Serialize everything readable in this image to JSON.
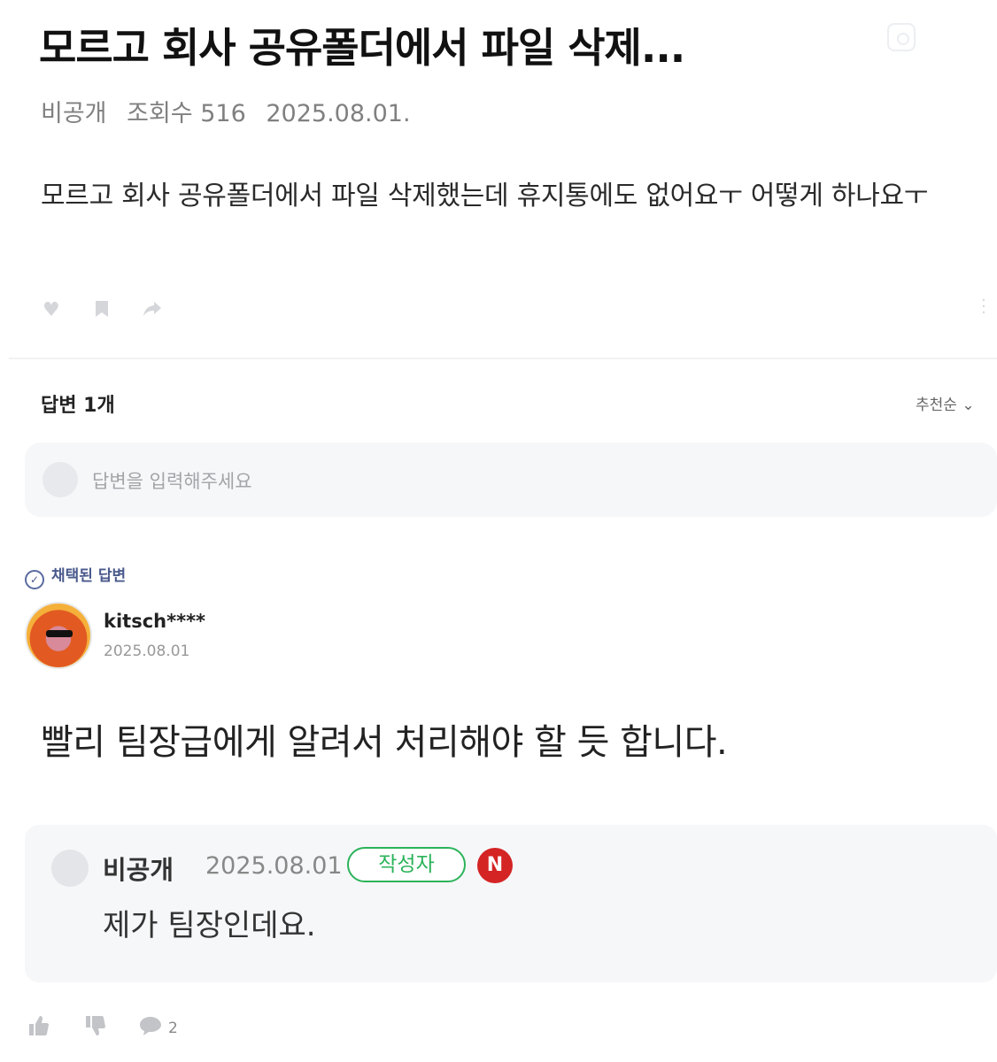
{
  "post": {
    "title": "모르고 회사 공유폴더에서 파일 삭제...",
    "author": "비공개",
    "views": "조회수 516",
    "date": "2025.08.01.",
    "body": "모르고 회사 공유폴더에서 파일 삭제했는데 휴지통에도 없어요ㅜ 어떻게 하나요ㅜ",
    "actions": [
      "heart-icon",
      "bookmark-icon",
      "share-icon"
    ]
  },
  "answers": {
    "count_label": "답변 1개",
    "sort_label": "추천순 ⌄",
    "input_placeholder": "답변을 입력해주세요"
  },
  "accepted_answer": {
    "badge_label": "채택된 답변",
    "username": "kitsch****",
    "date": "2025.08.01",
    "body": "빨리 팀장급에게 알려서 처리해야 할 듯 합니다.",
    "reply": {
      "name": "비공개",
      "date": "2025.08.01",
      "author_badge": "작성자",
      "n_badge": "N",
      "text": "제가 팀장인데요."
    },
    "footer": {
      "comment_count": "2"
    }
  },
  "colors": {
    "accent_green": "#2bb35a",
    "n_badge_red": "#d42424",
    "accepted_blue": "#4a5a8c"
  }
}
